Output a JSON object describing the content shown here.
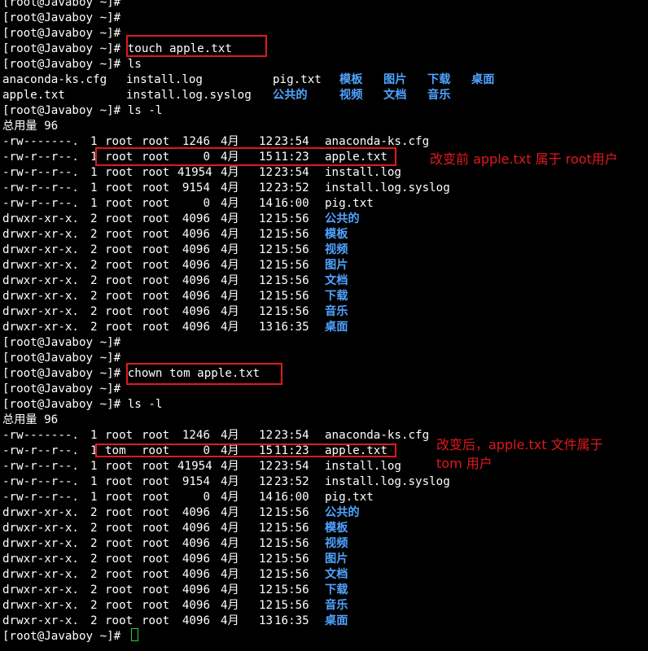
{
  "colors": {
    "background": "#000000",
    "text": "#ffffff",
    "directory": "#4fa3ff",
    "annotation": "#e0191f",
    "cursor": "#2ecc40"
  },
  "prompt": "[root@Javaboy ~]#",
  "session_top": [
    {
      "prompt": "[root@Javaboy ~]#",
      "command": ""
    },
    {
      "prompt": "[root@Javaboy ~]#",
      "command": ""
    },
    {
      "prompt": "[root@Javaboy ~]#",
      "command": ""
    },
    {
      "prompt": "[root@Javaboy ~]#",
      "command": " touch apple.txt"
    },
    {
      "prompt": "[root@Javaboy ~]#",
      "command": " ls"
    }
  ],
  "ls_output": {
    "row1": [
      "anaconda-ks.cfg",
      "install.log",
      "pig.txt",
      "模板",
      "图片",
      "下载",
      "桌面"
    ],
    "row2": [
      "apple.txt",
      "install.log.syslog",
      "公共的",
      "视频",
      "文档",
      "音乐"
    ]
  },
  "listing1": {
    "prompt": "[root@Javaboy ~]#",
    "command": " ls -l",
    "total": "总用量 96",
    "rows": [
      {
        "perm": "-rw-------.",
        "links": "1",
        "owner": "root",
        "group": "root",
        "size": "1246",
        "month": "4月",
        "day": "12",
        "time": "23:54",
        "name": "anaconda-ks.cfg",
        "dir": false
      },
      {
        "perm": "-rw-r--r--.",
        "links": "1",
        "owner": "root",
        "group": "root",
        "size": "0",
        "month": "4月",
        "day": "15",
        "time": "11:23",
        "name": "apple.txt",
        "dir": false
      },
      {
        "perm": "-rw-r--r--.",
        "links": "1",
        "owner": "root",
        "group": "root",
        "size": "41954",
        "month": "4月",
        "day": "12",
        "time": "23:54",
        "name": "install.log",
        "dir": false
      },
      {
        "perm": "-rw-r--r--.",
        "links": "1",
        "owner": "root",
        "group": "root",
        "size": "9154",
        "month": "4月",
        "day": "12",
        "time": "23:52",
        "name": "install.log.syslog",
        "dir": false
      },
      {
        "perm": "-rw-r--r--.",
        "links": "1",
        "owner": "root",
        "group": "root",
        "size": "0",
        "month": "4月",
        "day": "14",
        "time": "16:00",
        "name": "pig.txt",
        "dir": false
      },
      {
        "perm": "drwxr-xr-x.",
        "links": "2",
        "owner": "root",
        "group": "root",
        "size": "4096",
        "month": "4月",
        "day": "12",
        "time": "15:56",
        "name": "公共的",
        "dir": true
      },
      {
        "perm": "drwxr-xr-x.",
        "links": "2",
        "owner": "root",
        "group": "root",
        "size": "4096",
        "month": "4月",
        "day": "12",
        "time": "15:56",
        "name": "模板",
        "dir": true
      },
      {
        "perm": "drwxr-xr-x.",
        "links": "2",
        "owner": "root",
        "group": "root",
        "size": "4096",
        "month": "4月",
        "day": "12",
        "time": "15:56",
        "name": "视频",
        "dir": true
      },
      {
        "perm": "drwxr-xr-x.",
        "links": "2",
        "owner": "root",
        "group": "root",
        "size": "4096",
        "month": "4月",
        "day": "12",
        "time": "15:56",
        "name": "图片",
        "dir": true
      },
      {
        "perm": "drwxr-xr-x.",
        "links": "2",
        "owner": "root",
        "group": "root",
        "size": "4096",
        "month": "4月",
        "day": "12",
        "time": "15:56",
        "name": "文档",
        "dir": true
      },
      {
        "perm": "drwxr-xr-x.",
        "links": "2",
        "owner": "root",
        "group": "root",
        "size": "4096",
        "month": "4月",
        "day": "12",
        "time": "15:56",
        "name": "下载",
        "dir": true
      },
      {
        "perm": "drwxr-xr-x.",
        "links": "2",
        "owner": "root",
        "group": "root",
        "size": "4096",
        "month": "4月",
        "day": "12",
        "time": "15:56",
        "name": "音乐",
        "dir": true
      },
      {
        "perm": "drwxr-xr-x.",
        "links": "2",
        "owner": "root",
        "group": "root",
        "size": "4096",
        "month": "4月",
        "day": "13",
        "time": "16:35",
        "name": "桌面",
        "dir": true
      }
    ]
  },
  "session_mid": [
    {
      "prompt": "[root@Javaboy ~]#",
      "command": ""
    },
    {
      "prompt": "[root@Javaboy ~]#",
      "command": ""
    },
    {
      "prompt": "[root@Javaboy ~]#",
      "command": " chown tom apple.txt"
    },
    {
      "prompt": "[root@Javaboy ~]#",
      "command": ""
    }
  ],
  "listing2": {
    "prompt": "[root@Javaboy ~]#",
    "command": " ls -l",
    "total": "总用量 96",
    "rows": [
      {
        "perm": "-rw-------.",
        "links": "1",
        "owner": "root",
        "group": "root",
        "size": "1246",
        "month": "4月",
        "day": "12",
        "time": "23:54",
        "name": "anaconda-ks.cfg",
        "dir": false
      },
      {
        "perm": "-rw-r--r--.",
        "links": "1",
        "owner": "tom",
        "group": "root",
        "size": "0",
        "month": "4月",
        "day": "15",
        "time": "11:23",
        "name": "apple.txt",
        "dir": false
      },
      {
        "perm": "-rw-r--r--.",
        "links": "1",
        "owner": "root",
        "group": "root",
        "size": "41954",
        "month": "4月",
        "day": "12",
        "time": "23:54",
        "name": "install.log",
        "dir": false
      },
      {
        "perm": "-rw-r--r--.",
        "links": "1",
        "owner": "root",
        "group": "root",
        "size": "9154",
        "month": "4月",
        "day": "12",
        "time": "23:52",
        "name": "install.log.syslog",
        "dir": false
      },
      {
        "perm": "-rw-r--r--.",
        "links": "1",
        "owner": "root",
        "group": "root",
        "size": "0",
        "month": "4月",
        "day": "14",
        "time": "16:00",
        "name": "pig.txt",
        "dir": false
      },
      {
        "perm": "drwxr-xr-x.",
        "links": "2",
        "owner": "root",
        "group": "root",
        "size": "4096",
        "month": "4月",
        "day": "12",
        "time": "15:56",
        "name": "公共的",
        "dir": true
      },
      {
        "perm": "drwxr-xr-x.",
        "links": "2",
        "owner": "root",
        "group": "root",
        "size": "4096",
        "month": "4月",
        "day": "12",
        "time": "15:56",
        "name": "模板",
        "dir": true
      },
      {
        "perm": "drwxr-xr-x.",
        "links": "2",
        "owner": "root",
        "group": "root",
        "size": "4096",
        "month": "4月",
        "day": "12",
        "time": "15:56",
        "name": "视频",
        "dir": true
      },
      {
        "perm": "drwxr-xr-x.",
        "links": "2",
        "owner": "root",
        "group": "root",
        "size": "4096",
        "month": "4月",
        "day": "12",
        "time": "15:56",
        "name": "图片",
        "dir": true
      },
      {
        "perm": "drwxr-xr-x.",
        "links": "2",
        "owner": "root",
        "group": "root",
        "size": "4096",
        "month": "4月",
        "day": "12",
        "time": "15:56",
        "name": "文档",
        "dir": true
      },
      {
        "perm": "drwxr-xr-x.",
        "links": "2",
        "owner": "root",
        "group": "root",
        "size": "4096",
        "month": "4月",
        "day": "12",
        "time": "15:56",
        "name": "下载",
        "dir": true
      },
      {
        "perm": "drwxr-xr-x.",
        "links": "2",
        "owner": "root",
        "group": "root",
        "size": "4096",
        "month": "4月",
        "day": "12",
        "time": "15:56",
        "name": "音乐",
        "dir": true
      },
      {
        "perm": "drwxr-xr-x.",
        "links": "2",
        "owner": "root",
        "group": "root",
        "size": "4096",
        "month": "4月",
        "day": "13",
        "time": "16:35",
        "name": "桌面",
        "dir": true
      }
    ]
  },
  "final_prompt": "[root@Javaboy ~]#",
  "annotations": {
    "before": "改变前 apple.txt 属于 root用户",
    "after_line1": "改变后，apple.txt 文件属于",
    "after_line2": "tom 用户"
  }
}
